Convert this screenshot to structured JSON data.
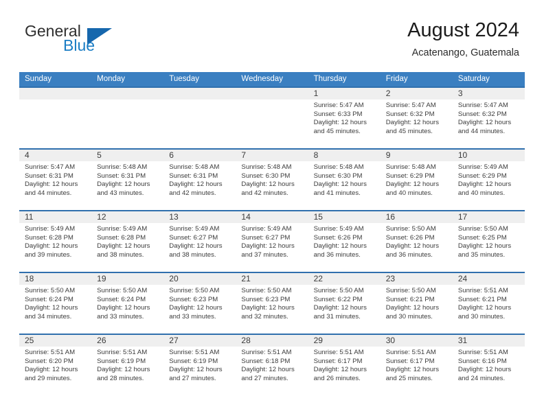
{
  "brand": {
    "name_top": "General",
    "name_bottom": "Blue",
    "accent_color": "#1a7dc4",
    "flag_color": "#1667ad"
  },
  "header": {
    "title": "August 2024",
    "subtitle": "Acatenango, Guatemala"
  },
  "theme": {
    "header_bar_color": "#3a7fc1",
    "row_border_color": "#2f6fad",
    "daynum_band_color": "#efefef",
    "text_color": "#3b3b3b"
  },
  "weekdays": [
    "Sunday",
    "Monday",
    "Tuesday",
    "Wednesday",
    "Thursday",
    "Friday",
    "Saturday"
  ],
  "labels": {
    "sunrise": "Sunrise:",
    "sunset": "Sunset:",
    "daylight": "Daylight:"
  },
  "weeks": [
    [
      {
        "day": "",
        "empty": true
      },
      {
        "day": "",
        "empty": true
      },
      {
        "day": "",
        "empty": true
      },
      {
        "day": "",
        "empty": true
      },
      {
        "day": "1",
        "sunrise": "Sunrise: 5:47 AM",
        "sunset": "Sunset: 6:33 PM",
        "daylight1": "Daylight: 12 hours",
        "daylight2": "and 45 minutes."
      },
      {
        "day": "2",
        "sunrise": "Sunrise: 5:47 AM",
        "sunset": "Sunset: 6:32 PM",
        "daylight1": "Daylight: 12 hours",
        "daylight2": "and 45 minutes."
      },
      {
        "day": "3",
        "sunrise": "Sunrise: 5:47 AM",
        "sunset": "Sunset: 6:32 PM",
        "daylight1": "Daylight: 12 hours",
        "daylight2": "and 44 minutes."
      }
    ],
    [
      {
        "day": "4",
        "sunrise": "Sunrise: 5:47 AM",
        "sunset": "Sunset: 6:31 PM",
        "daylight1": "Daylight: 12 hours",
        "daylight2": "and 44 minutes."
      },
      {
        "day": "5",
        "sunrise": "Sunrise: 5:48 AM",
        "sunset": "Sunset: 6:31 PM",
        "daylight1": "Daylight: 12 hours",
        "daylight2": "and 43 minutes."
      },
      {
        "day": "6",
        "sunrise": "Sunrise: 5:48 AM",
        "sunset": "Sunset: 6:31 PM",
        "daylight1": "Daylight: 12 hours",
        "daylight2": "and 42 minutes."
      },
      {
        "day": "7",
        "sunrise": "Sunrise: 5:48 AM",
        "sunset": "Sunset: 6:30 PM",
        "daylight1": "Daylight: 12 hours",
        "daylight2": "and 42 minutes."
      },
      {
        "day": "8",
        "sunrise": "Sunrise: 5:48 AM",
        "sunset": "Sunset: 6:30 PM",
        "daylight1": "Daylight: 12 hours",
        "daylight2": "and 41 minutes."
      },
      {
        "day": "9",
        "sunrise": "Sunrise: 5:48 AM",
        "sunset": "Sunset: 6:29 PM",
        "daylight1": "Daylight: 12 hours",
        "daylight2": "and 40 minutes."
      },
      {
        "day": "10",
        "sunrise": "Sunrise: 5:49 AM",
        "sunset": "Sunset: 6:29 PM",
        "daylight1": "Daylight: 12 hours",
        "daylight2": "and 40 minutes."
      }
    ],
    [
      {
        "day": "11",
        "sunrise": "Sunrise: 5:49 AM",
        "sunset": "Sunset: 6:28 PM",
        "daylight1": "Daylight: 12 hours",
        "daylight2": "and 39 minutes."
      },
      {
        "day": "12",
        "sunrise": "Sunrise: 5:49 AM",
        "sunset": "Sunset: 6:28 PM",
        "daylight1": "Daylight: 12 hours",
        "daylight2": "and 38 minutes."
      },
      {
        "day": "13",
        "sunrise": "Sunrise: 5:49 AM",
        "sunset": "Sunset: 6:27 PM",
        "daylight1": "Daylight: 12 hours",
        "daylight2": "and 38 minutes."
      },
      {
        "day": "14",
        "sunrise": "Sunrise: 5:49 AM",
        "sunset": "Sunset: 6:27 PM",
        "daylight1": "Daylight: 12 hours",
        "daylight2": "and 37 minutes."
      },
      {
        "day": "15",
        "sunrise": "Sunrise: 5:49 AM",
        "sunset": "Sunset: 6:26 PM",
        "daylight1": "Daylight: 12 hours",
        "daylight2": "and 36 minutes."
      },
      {
        "day": "16",
        "sunrise": "Sunrise: 5:50 AM",
        "sunset": "Sunset: 6:26 PM",
        "daylight1": "Daylight: 12 hours",
        "daylight2": "and 36 minutes."
      },
      {
        "day": "17",
        "sunrise": "Sunrise: 5:50 AM",
        "sunset": "Sunset: 6:25 PM",
        "daylight1": "Daylight: 12 hours",
        "daylight2": "and 35 minutes."
      }
    ],
    [
      {
        "day": "18",
        "sunrise": "Sunrise: 5:50 AM",
        "sunset": "Sunset: 6:24 PM",
        "daylight1": "Daylight: 12 hours",
        "daylight2": "and 34 minutes."
      },
      {
        "day": "19",
        "sunrise": "Sunrise: 5:50 AM",
        "sunset": "Sunset: 6:24 PM",
        "daylight1": "Daylight: 12 hours",
        "daylight2": "and 33 minutes."
      },
      {
        "day": "20",
        "sunrise": "Sunrise: 5:50 AM",
        "sunset": "Sunset: 6:23 PM",
        "daylight1": "Daylight: 12 hours",
        "daylight2": "and 33 minutes."
      },
      {
        "day": "21",
        "sunrise": "Sunrise: 5:50 AM",
        "sunset": "Sunset: 6:23 PM",
        "daylight1": "Daylight: 12 hours",
        "daylight2": "and 32 minutes."
      },
      {
        "day": "22",
        "sunrise": "Sunrise: 5:50 AM",
        "sunset": "Sunset: 6:22 PM",
        "daylight1": "Daylight: 12 hours",
        "daylight2": "and 31 minutes."
      },
      {
        "day": "23",
        "sunrise": "Sunrise: 5:50 AM",
        "sunset": "Sunset: 6:21 PM",
        "daylight1": "Daylight: 12 hours",
        "daylight2": "and 30 minutes."
      },
      {
        "day": "24",
        "sunrise": "Sunrise: 5:51 AM",
        "sunset": "Sunset: 6:21 PM",
        "daylight1": "Daylight: 12 hours",
        "daylight2": "and 30 minutes."
      }
    ],
    [
      {
        "day": "25",
        "sunrise": "Sunrise: 5:51 AM",
        "sunset": "Sunset: 6:20 PM",
        "daylight1": "Daylight: 12 hours",
        "daylight2": "and 29 minutes."
      },
      {
        "day": "26",
        "sunrise": "Sunrise: 5:51 AM",
        "sunset": "Sunset: 6:19 PM",
        "daylight1": "Daylight: 12 hours",
        "daylight2": "and 28 minutes."
      },
      {
        "day": "27",
        "sunrise": "Sunrise: 5:51 AM",
        "sunset": "Sunset: 6:19 PM",
        "daylight1": "Daylight: 12 hours",
        "daylight2": "and 27 minutes."
      },
      {
        "day": "28",
        "sunrise": "Sunrise: 5:51 AM",
        "sunset": "Sunset: 6:18 PM",
        "daylight1": "Daylight: 12 hours",
        "daylight2": "and 27 minutes."
      },
      {
        "day": "29",
        "sunrise": "Sunrise: 5:51 AM",
        "sunset": "Sunset: 6:17 PM",
        "daylight1": "Daylight: 12 hours",
        "daylight2": "and 26 minutes."
      },
      {
        "day": "30",
        "sunrise": "Sunrise: 5:51 AM",
        "sunset": "Sunset: 6:17 PM",
        "daylight1": "Daylight: 12 hours",
        "daylight2": "and 25 minutes."
      },
      {
        "day": "31",
        "sunrise": "Sunrise: 5:51 AM",
        "sunset": "Sunset: 6:16 PM",
        "daylight1": "Daylight: 12 hours",
        "daylight2": "and 24 minutes."
      }
    ]
  ]
}
